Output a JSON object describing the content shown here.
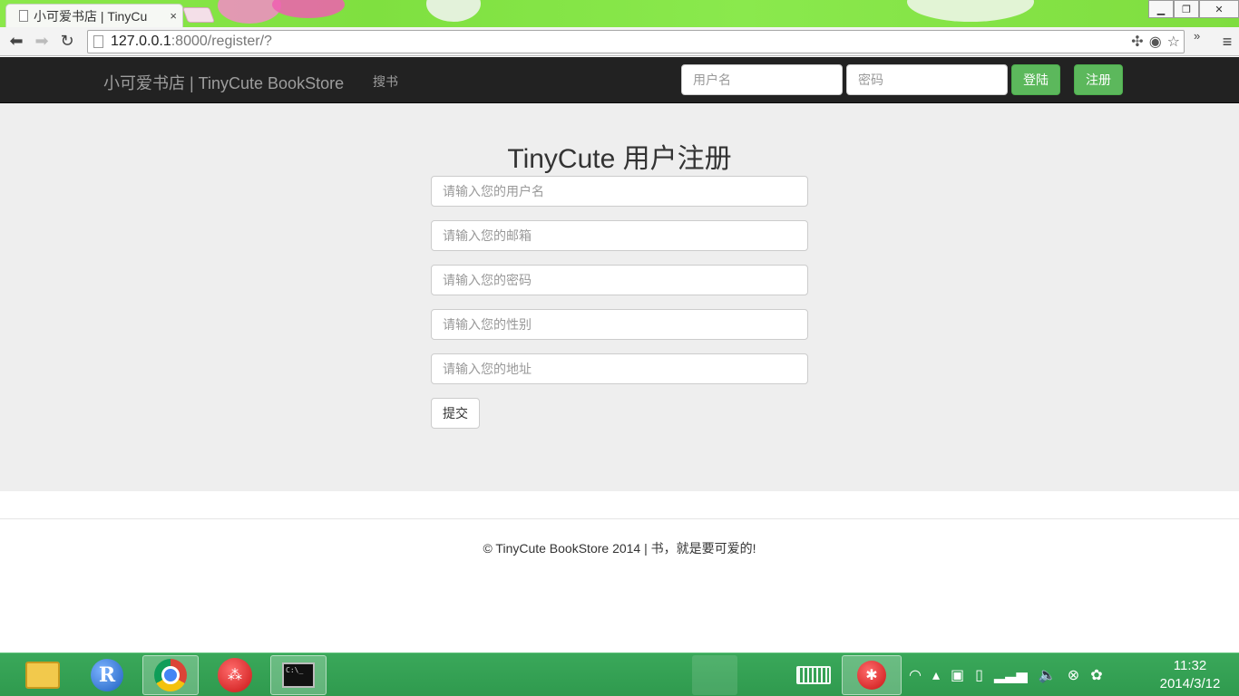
{
  "browser": {
    "tab_title": "小可爱书店 | TinyCu",
    "tab_close": "×",
    "url_host": "127.0.0.1",
    "url_path": ":8000/register/?",
    "menu_glyph": "≡",
    "extra_glyph": "»"
  },
  "navbar": {
    "brand": "小可爱书店 | TinyCute BookStore",
    "search_link": "搜书",
    "username_placeholder": "用户名",
    "password_placeholder": "密码",
    "login_button": "登陆",
    "register_button": "注册"
  },
  "register_form": {
    "title": "TinyCute 用户注册",
    "username_placeholder": "请输入您的用户名",
    "email_placeholder": "请输入您的邮箱",
    "password_placeholder": "请输入您的密码",
    "gender_placeholder": "请输入您的性别",
    "address_placeholder": "请输入您的地址",
    "submit_button": "提交"
  },
  "footer": {
    "text": "© TinyCute BookStore 2014 | 书，就是要可爱的!"
  },
  "taskbar": {
    "apps": [
      "file-explorer",
      "r-gui",
      "chrome",
      "red-app",
      "command-prompt"
    ],
    "clock_time": "11:32",
    "clock_date": "2014/3/12"
  },
  "colors": {
    "navbar_bg": "#222222",
    "success_green": "#5cb85c",
    "jumbotron_bg": "#eeeeee",
    "taskbar_green": "#34a156"
  }
}
